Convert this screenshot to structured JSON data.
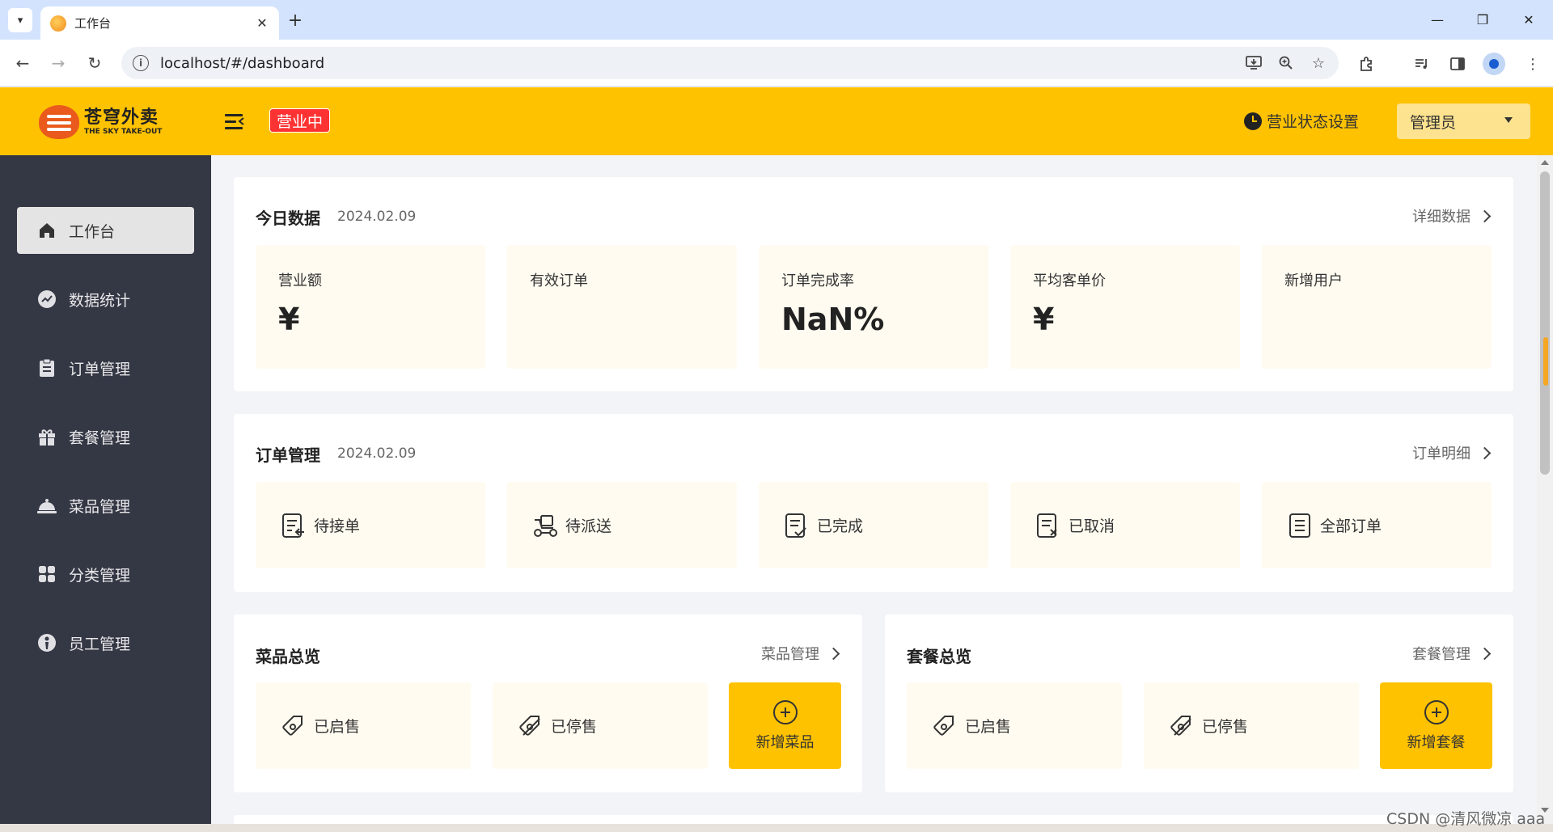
{
  "browser": {
    "tab_title": "工作台",
    "url": "localhost/#/dashboard"
  },
  "header": {
    "logo_cn": "苍穹外卖",
    "logo_en": "THE SKY TAKE-OUT",
    "status": "营业中",
    "settings": "营业状态设置",
    "admin": "管理员",
    "accent": "#ffc200"
  },
  "sidebar": {
    "items": [
      {
        "label": "工作台",
        "icon": "home-icon",
        "active": true
      },
      {
        "label": "数据统计",
        "icon": "chart-icon",
        "active": false
      },
      {
        "label": "订单管理",
        "icon": "clipboard-icon",
        "active": false
      },
      {
        "label": "套餐管理",
        "icon": "gift-icon",
        "active": false
      },
      {
        "label": "菜品管理",
        "icon": "cloche-icon",
        "active": false
      },
      {
        "label": "分类管理",
        "icon": "grid-icon",
        "active": false
      },
      {
        "label": "员工管理",
        "icon": "employee-icon",
        "active": false
      }
    ]
  },
  "today": {
    "title": "今日数据",
    "date": "2024.02.09",
    "link": "详细数据",
    "stats": [
      {
        "label": "营业额",
        "value": "¥"
      },
      {
        "label": "有效订单",
        "value": ""
      },
      {
        "label": "订单完成率",
        "value": "NaN%"
      },
      {
        "label": "平均客单价",
        "value": "¥"
      },
      {
        "label": "新增用户",
        "value": ""
      }
    ]
  },
  "orders": {
    "title": "订单管理",
    "date": "2024.02.09",
    "link": "订单明细",
    "items": [
      {
        "label": "待接单",
        "icon": "pending-order-icon"
      },
      {
        "label": "待派送",
        "icon": "delivery-icon"
      },
      {
        "label": "已完成",
        "icon": "completed-order-icon"
      },
      {
        "label": "已取消",
        "icon": "cancelled-order-icon"
      },
      {
        "label": "全部订单",
        "icon": "all-orders-icon"
      }
    ]
  },
  "dishes": {
    "title": "菜品总览",
    "link": "菜品管理",
    "on_sale": "已启售",
    "off_sale": "已停售",
    "add": "新增菜品"
  },
  "setmeals": {
    "title": "套餐总览",
    "link": "套餐管理",
    "on_sale": "已启售",
    "off_sale": "已停售",
    "add": "新增套餐"
  },
  "watermark": "CSDN @清风微凉 aaa"
}
